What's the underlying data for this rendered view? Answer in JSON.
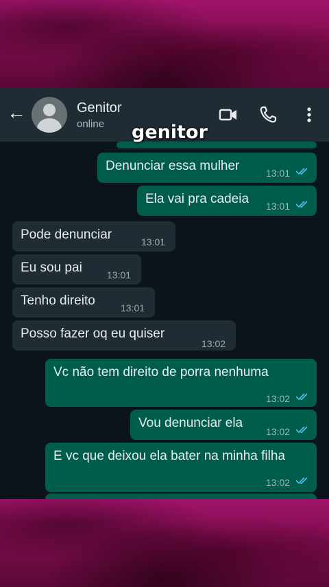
{
  "header": {
    "back_icon": "arrow-left-icon",
    "contact_name": "Genitor",
    "status": "online",
    "overlay_title": "genitor",
    "icons": [
      "video-call-icon",
      "phone-icon",
      "more-vert-icon"
    ]
  },
  "messages": [
    {
      "direction": "out",
      "text": "Denunciar essa mulher",
      "time": "13:01",
      "read": true
    },
    {
      "direction": "out",
      "text": "Ela vai pra cadeia",
      "time": "13:01",
      "read": true
    },
    {
      "direction": "in",
      "text": "Pode denunciar",
      "time": "13:01"
    },
    {
      "direction": "in",
      "text": "Eu sou pai",
      "time": "13:01"
    },
    {
      "direction": "in",
      "text": "Tenho direito",
      "time": "13:01"
    },
    {
      "direction": "in",
      "text": "Posso fazer oq eu quiser",
      "time": "13:02"
    },
    {
      "direction": "out",
      "text": "Vc não tem direito de porra nenhuma",
      "time": "13:02",
      "read": true
    },
    {
      "direction": "out",
      "text": "Vou denunciar ela",
      "time": "13:02",
      "read": true
    },
    {
      "direction": "out",
      "text": "E vc que deixou ela bater na minha filha",
      "time": "13:02",
      "read": true
    }
  ],
  "colors": {
    "outgoing_bubble": "#005c4b",
    "incoming_bubble": "#1f2c34",
    "chat_background": "#0b141a",
    "read_tick": "#53bdeb",
    "frame": "#8a0f55"
  }
}
